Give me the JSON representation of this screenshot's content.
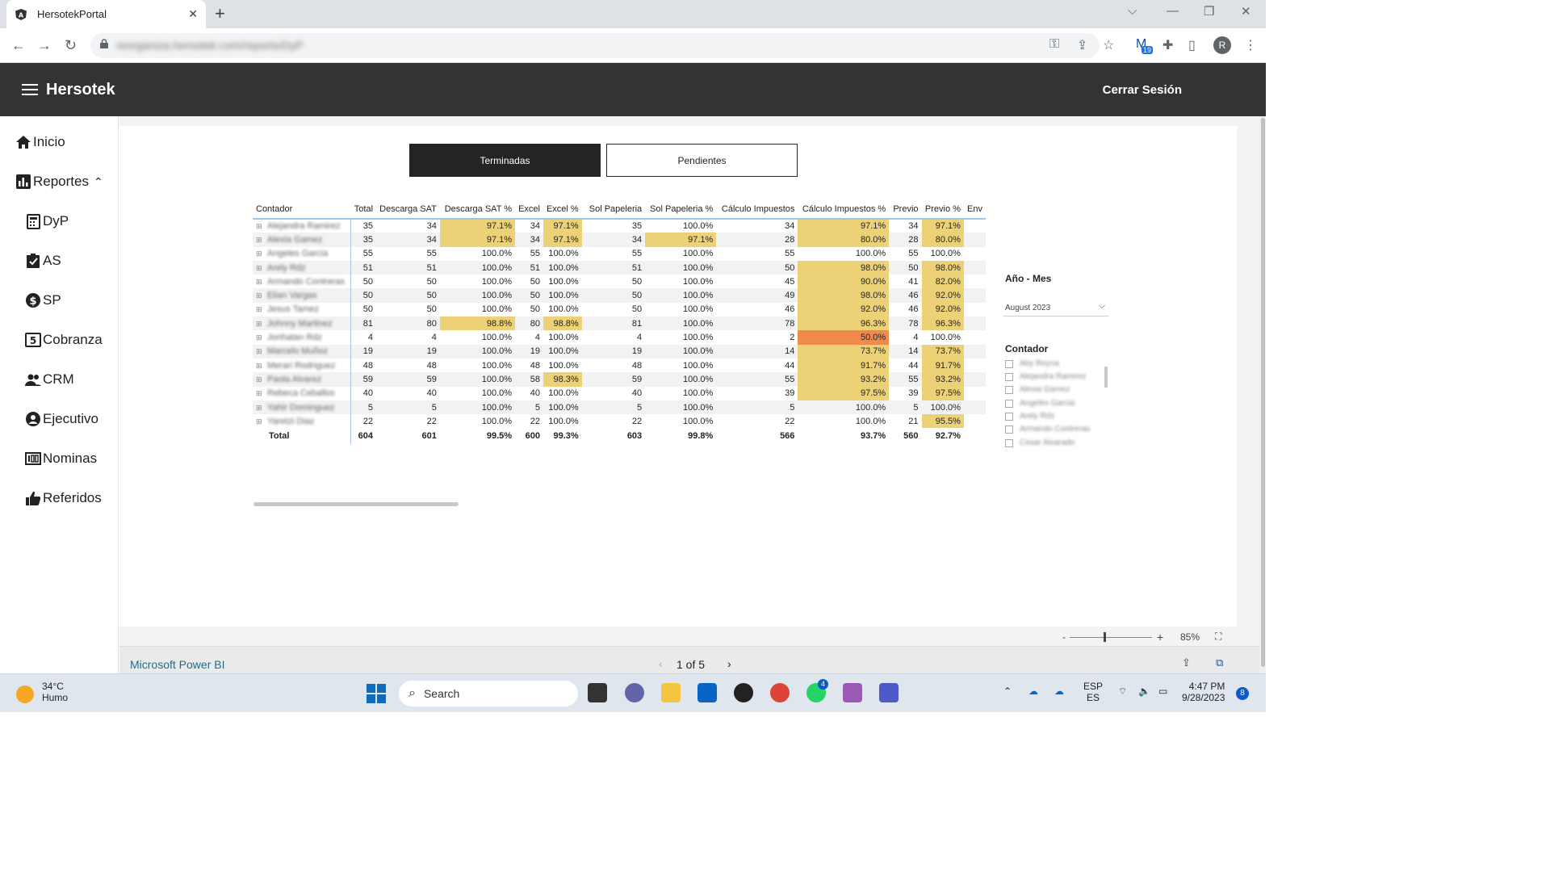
{
  "browser": {
    "tab_title": "HersotekPortal",
    "url": "reorganiza.hersotek.com/reports/DyP",
    "extension_badge": "19",
    "profile_initial": "R"
  },
  "app": {
    "brand": "Hersotek",
    "logout": "Cerrar Sesión"
  },
  "sidebar": {
    "items": [
      {
        "label": "Inicio",
        "icon": "home-icon"
      },
      {
        "label": "Reportes",
        "icon": "chart-icon"
      },
      {
        "label": "DyP",
        "icon": "calculator-icon"
      },
      {
        "label": "AS",
        "icon": "clipboard-check-icon"
      },
      {
        "label": "SP",
        "icon": "dollar-icon"
      },
      {
        "label": "Cobranza",
        "icon": "cash-icon"
      },
      {
        "label": "CRM",
        "icon": "users-icon"
      },
      {
        "label": "Ejecutivo",
        "icon": "user-circle-icon"
      },
      {
        "label": "Nominas",
        "icon": "payroll-icon"
      },
      {
        "label": "Referidos",
        "icon": "thumbs-up-icon"
      }
    ]
  },
  "report": {
    "tab_done": "Terminadas",
    "tab_pending": "Pendientes",
    "columns": [
      "Contador",
      "Total",
      "Descarga SAT",
      "Descarga SAT %",
      "Excel",
      "Excel %",
      "Sol Papeleria",
      "Sol Papeleria %",
      "Cálculo Impuestos",
      "Cálculo Impuestos %",
      "Previo",
      "Previo %",
      "Env"
    ],
    "rows": [
      {
        "name": "Alejandra Ramirez",
        "vals": [
          "35",
          "34",
          "97.1%",
          "34",
          "97.1%",
          "35",
          "100.0%",
          "34",
          "97.1%",
          "34",
          "97.1%"
        ]
      },
      {
        "name": "Alexia Gamez",
        "vals": [
          "35",
          "34",
          "97.1%",
          "34",
          "97.1%",
          "34",
          "97.1%",
          "28",
          "80.0%",
          "28",
          "80.0%"
        ]
      },
      {
        "name": "Angeles Garcia",
        "vals": [
          "55",
          "55",
          "100.0%",
          "55",
          "100.0%",
          "55",
          "100.0%",
          "55",
          "100.0%",
          "55",
          "100.0%"
        ]
      },
      {
        "name": "Arely Rdz",
        "vals": [
          "51",
          "51",
          "100.0%",
          "51",
          "100.0%",
          "51",
          "100.0%",
          "50",
          "98.0%",
          "50",
          "98.0%"
        ]
      },
      {
        "name": "Armando Contreras",
        "vals": [
          "50",
          "50",
          "100.0%",
          "50",
          "100.0%",
          "50",
          "100.0%",
          "45",
          "90.0%",
          "41",
          "82.0%"
        ]
      },
      {
        "name": "Elian Vargas",
        "vals": [
          "50",
          "50",
          "100.0%",
          "50",
          "100.0%",
          "50",
          "100.0%",
          "49",
          "98.0%",
          "46",
          "92.0%"
        ]
      },
      {
        "name": "Jesus Tamez",
        "vals": [
          "50",
          "50",
          "100.0%",
          "50",
          "100.0%",
          "50",
          "100.0%",
          "46",
          "92.0%",
          "46",
          "92.0%"
        ]
      },
      {
        "name": "Johnny Martinez",
        "vals": [
          "81",
          "80",
          "98.8%",
          "80",
          "98.8%",
          "81",
          "100.0%",
          "78",
          "96.3%",
          "78",
          "96.3%"
        ]
      },
      {
        "name": "Jonhatan Rdz",
        "vals": [
          "4",
          "4",
          "100.0%",
          "4",
          "100.0%",
          "4",
          "100.0%",
          "2",
          "50.0%",
          "4",
          "100.0%"
        ]
      },
      {
        "name": "Marcelo Muñoz",
        "vals": [
          "19",
          "19",
          "100.0%",
          "19",
          "100.0%",
          "19",
          "100.0%",
          "14",
          "73.7%",
          "14",
          "73.7%"
        ]
      },
      {
        "name": "Merari Rodriguez",
        "vals": [
          "48",
          "48",
          "100.0%",
          "48",
          "100.0%",
          "48",
          "100.0%",
          "44",
          "91.7%",
          "44",
          "91.7%"
        ]
      },
      {
        "name": "Paola Alvarez",
        "vals": [
          "59",
          "59",
          "100.0%",
          "58",
          "98.3%",
          "59",
          "100.0%",
          "55",
          "93.2%",
          "55",
          "93.2%"
        ]
      },
      {
        "name": "Rebeca Ceballos",
        "vals": [
          "40",
          "40",
          "100.0%",
          "40",
          "100.0%",
          "40",
          "100.0%",
          "39",
          "97.5%",
          "39",
          "97.5%"
        ]
      },
      {
        "name": "Yahir Dominguez",
        "vals": [
          "5",
          "5",
          "100.0%",
          "5",
          "100.0%",
          "5",
          "100.0%",
          "5",
          "100.0%",
          "5",
          "100.0%"
        ]
      },
      {
        "name": "Yaretzi Diaz",
        "vals": [
          "22",
          "22",
          "100.0%",
          "22",
          "100.0%",
          "22",
          "100.0%",
          "22",
          "100.0%",
          "21",
          "95.5%"
        ]
      }
    ],
    "total": {
      "name": "Total",
      "vals": [
        "604",
        "601",
        "99.5%",
        "600",
        "99.3%",
        "603",
        "99.8%",
        "566",
        "93.7%",
        "560",
        "92.7%"
      ]
    },
    "highlight_colors": {
      "warning": "#ecd177",
      "critical": "#f08a4b"
    }
  },
  "slicers": {
    "date_title": "Año - Mes",
    "date_value": "August 2023",
    "contador_title": "Contador",
    "contador_items": [
      "Aby Reyna",
      "Alejandra Ramirez",
      "Alexia Gamez",
      "Angeles Garcia",
      "Arely Rdz",
      "Armando Contreras",
      "Cesar Alvarado"
    ]
  },
  "zoom": {
    "minus": "-",
    "plus": "+",
    "level": "85%"
  },
  "footer": {
    "brand": "Microsoft Power BI",
    "page": "1 of 5"
  },
  "taskbar": {
    "temperature": "34°C",
    "condition": "Humo",
    "search": "Search",
    "teams_badge": "4",
    "lang1": "ESP",
    "lang2": "ES",
    "time": "4:47 PM",
    "date": "9/28/2023",
    "notifications": "8"
  }
}
